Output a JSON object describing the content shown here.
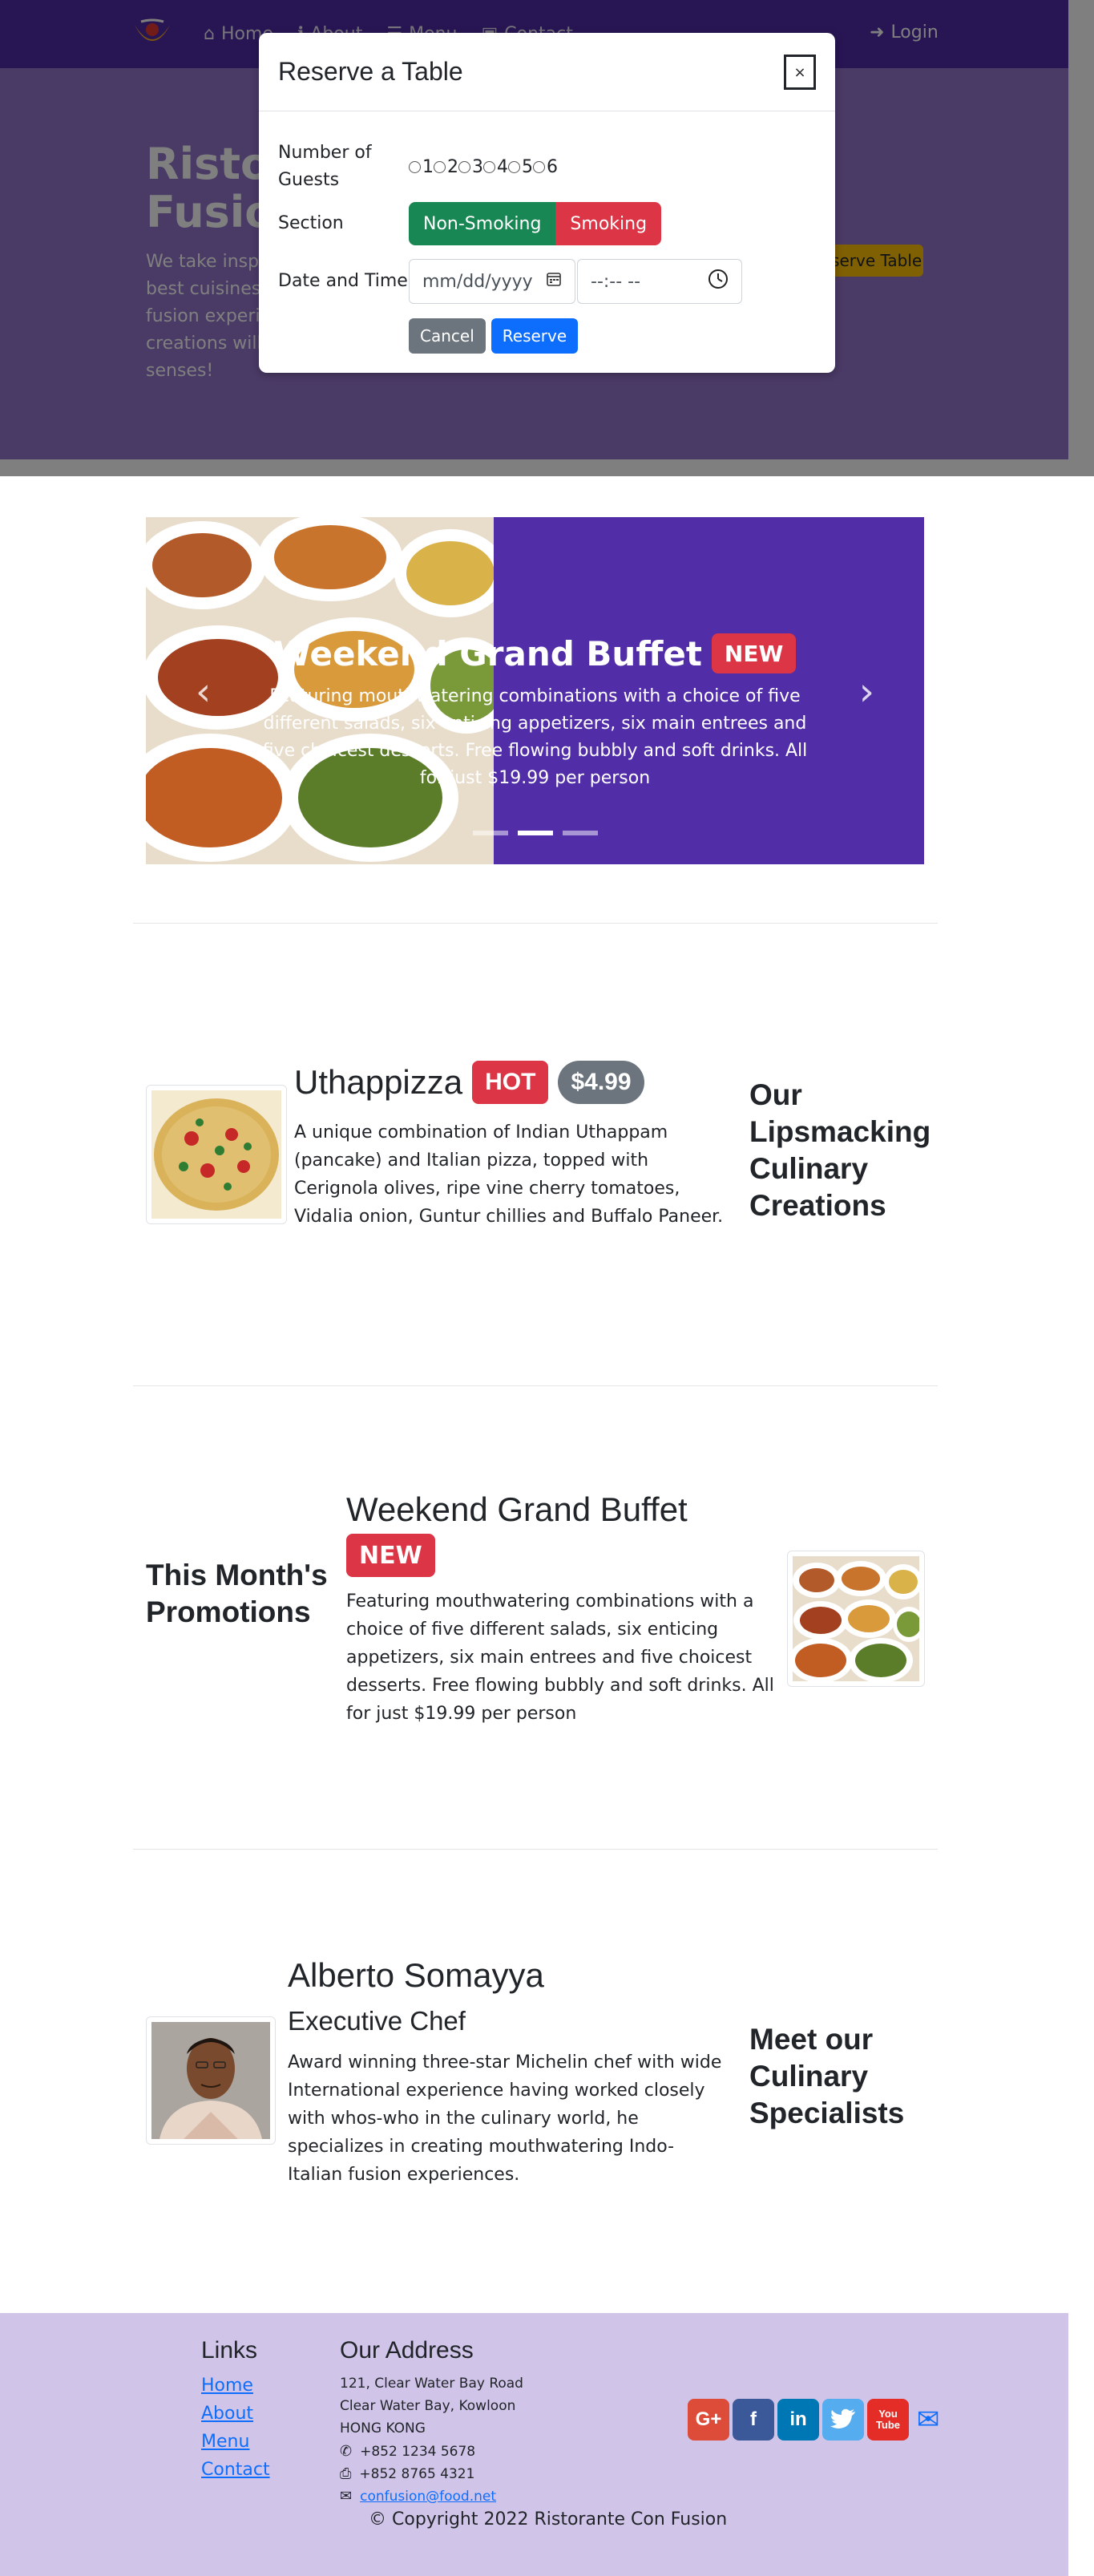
{
  "nav": {
    "items": [
      {
        "label": "Home",
        "icon": "home-icon"
      },
      {
        "label": "About",
        "icon": "info-icon"
      },
      {
        "label": "Menu",
        "icon": "list-icon"
      },
      {
        "label": "Contact",
        "icon": "address-card-icon"
      }
    ],
    "login": "Login"
  },
  "jumbotron": {
    "title_line1": "Ristorante con",
    "title_line2": "Fusion",
    "text": "We take inspiration from the World's best cuisines, and create a unique fusion experience. Our lipsmacking creations will tickle your culinary senses!",
    "reserve_button": "Reserve Table"
  },
  "modal": {
    "title": "Reserve a Table",
    "close": "×",
    "guests_label": "Number of Guests",
    "guest_options": [
      "1",
      "2",
      "3",
      "4",
      "5",
      "6"
    ],
    "section_label": "Section",
    "non_smoking": "Non-Smoking",
    "smoking": "Smoking",
    "datetime_label": "Date and Time",
    "date_placeholder": "mm/dd/yyyy",
    "time_placeholder": "--:-- --",
    "cancel": "Cancel",
    "reserve": "Reserve"
  },
  "carousel": {
    "title": "Weekend Grand Buffet",
    "badge": "NEW",
    "text": "Featuring mouthwatering combinations with a choice of five different salads, six enticing appetizers, six main entrees and five choicest desserts. Free flowing bubbly and soft drinks. All for just $19.99 per person",
    "slide_count": 3,
    "active_slide": 2
  },
  "dish": {
    "name": "Uthappizza",
    "badge": "HOT",
    "price": "$4.99",
    "description": "A unique combination of Indian Uthappam (pancake) and Italian pizza, topped with Cerignola olives, ripe vine cherry tomatoes, Vidalia onion, Guntur chillies and Buffalo Paneer.",
    "side_heading": "Our Lipsmacking Culinary Creations"
  },
  "promotion": {
    "side_heading": "This Month's Promotions",
    "name": "Weekend Grand Buffet",
    "badge": "NEW",
    "description": "Featuring mouthwatering combinations with a choice of five different salads, six enticing appetizers, six main entrees and five choicest desserts. Free flowing bubbly and soft drinks. All for just $19.99 per person"
  },
  "leader": {
    "name": "Alberto Somayya",
    "designation": "Executive Chef",
    "description": "Award winning three-star Michelin chef with wide International experience having worked closely with whos-who in the culinary world, he specializes in creating mouthwatering Indo-Italian fusion experiences.",
    "side_heading": "Meet our Culinary Specialists"
  },
  "footer": {
    "links_heading": "Links",
    "links": [
      "Home",
      "About",
      "Menu",
      "Contact"
    ],
    "address_heading": "Our Address",
    "address": [
      "121, Clear Water Bay Road",
      "Clear Water Bay, Kowloon",
      "HONG KONG"
    ],
    "phone": "+852 1234 5678",
    "fax": "+852 8765 4321",
    "email": "confusion@food.net",
    "copyright": "© Copyright 2022 Ristorante Con Fusion"
  },
  "colors": {
    "primary": "#512da8",
    "light": "#d1c4e9",
    "jumbotron": "#9575cd",
    "danger": "#dc3545",
    "success": "#198754"
  }
}
